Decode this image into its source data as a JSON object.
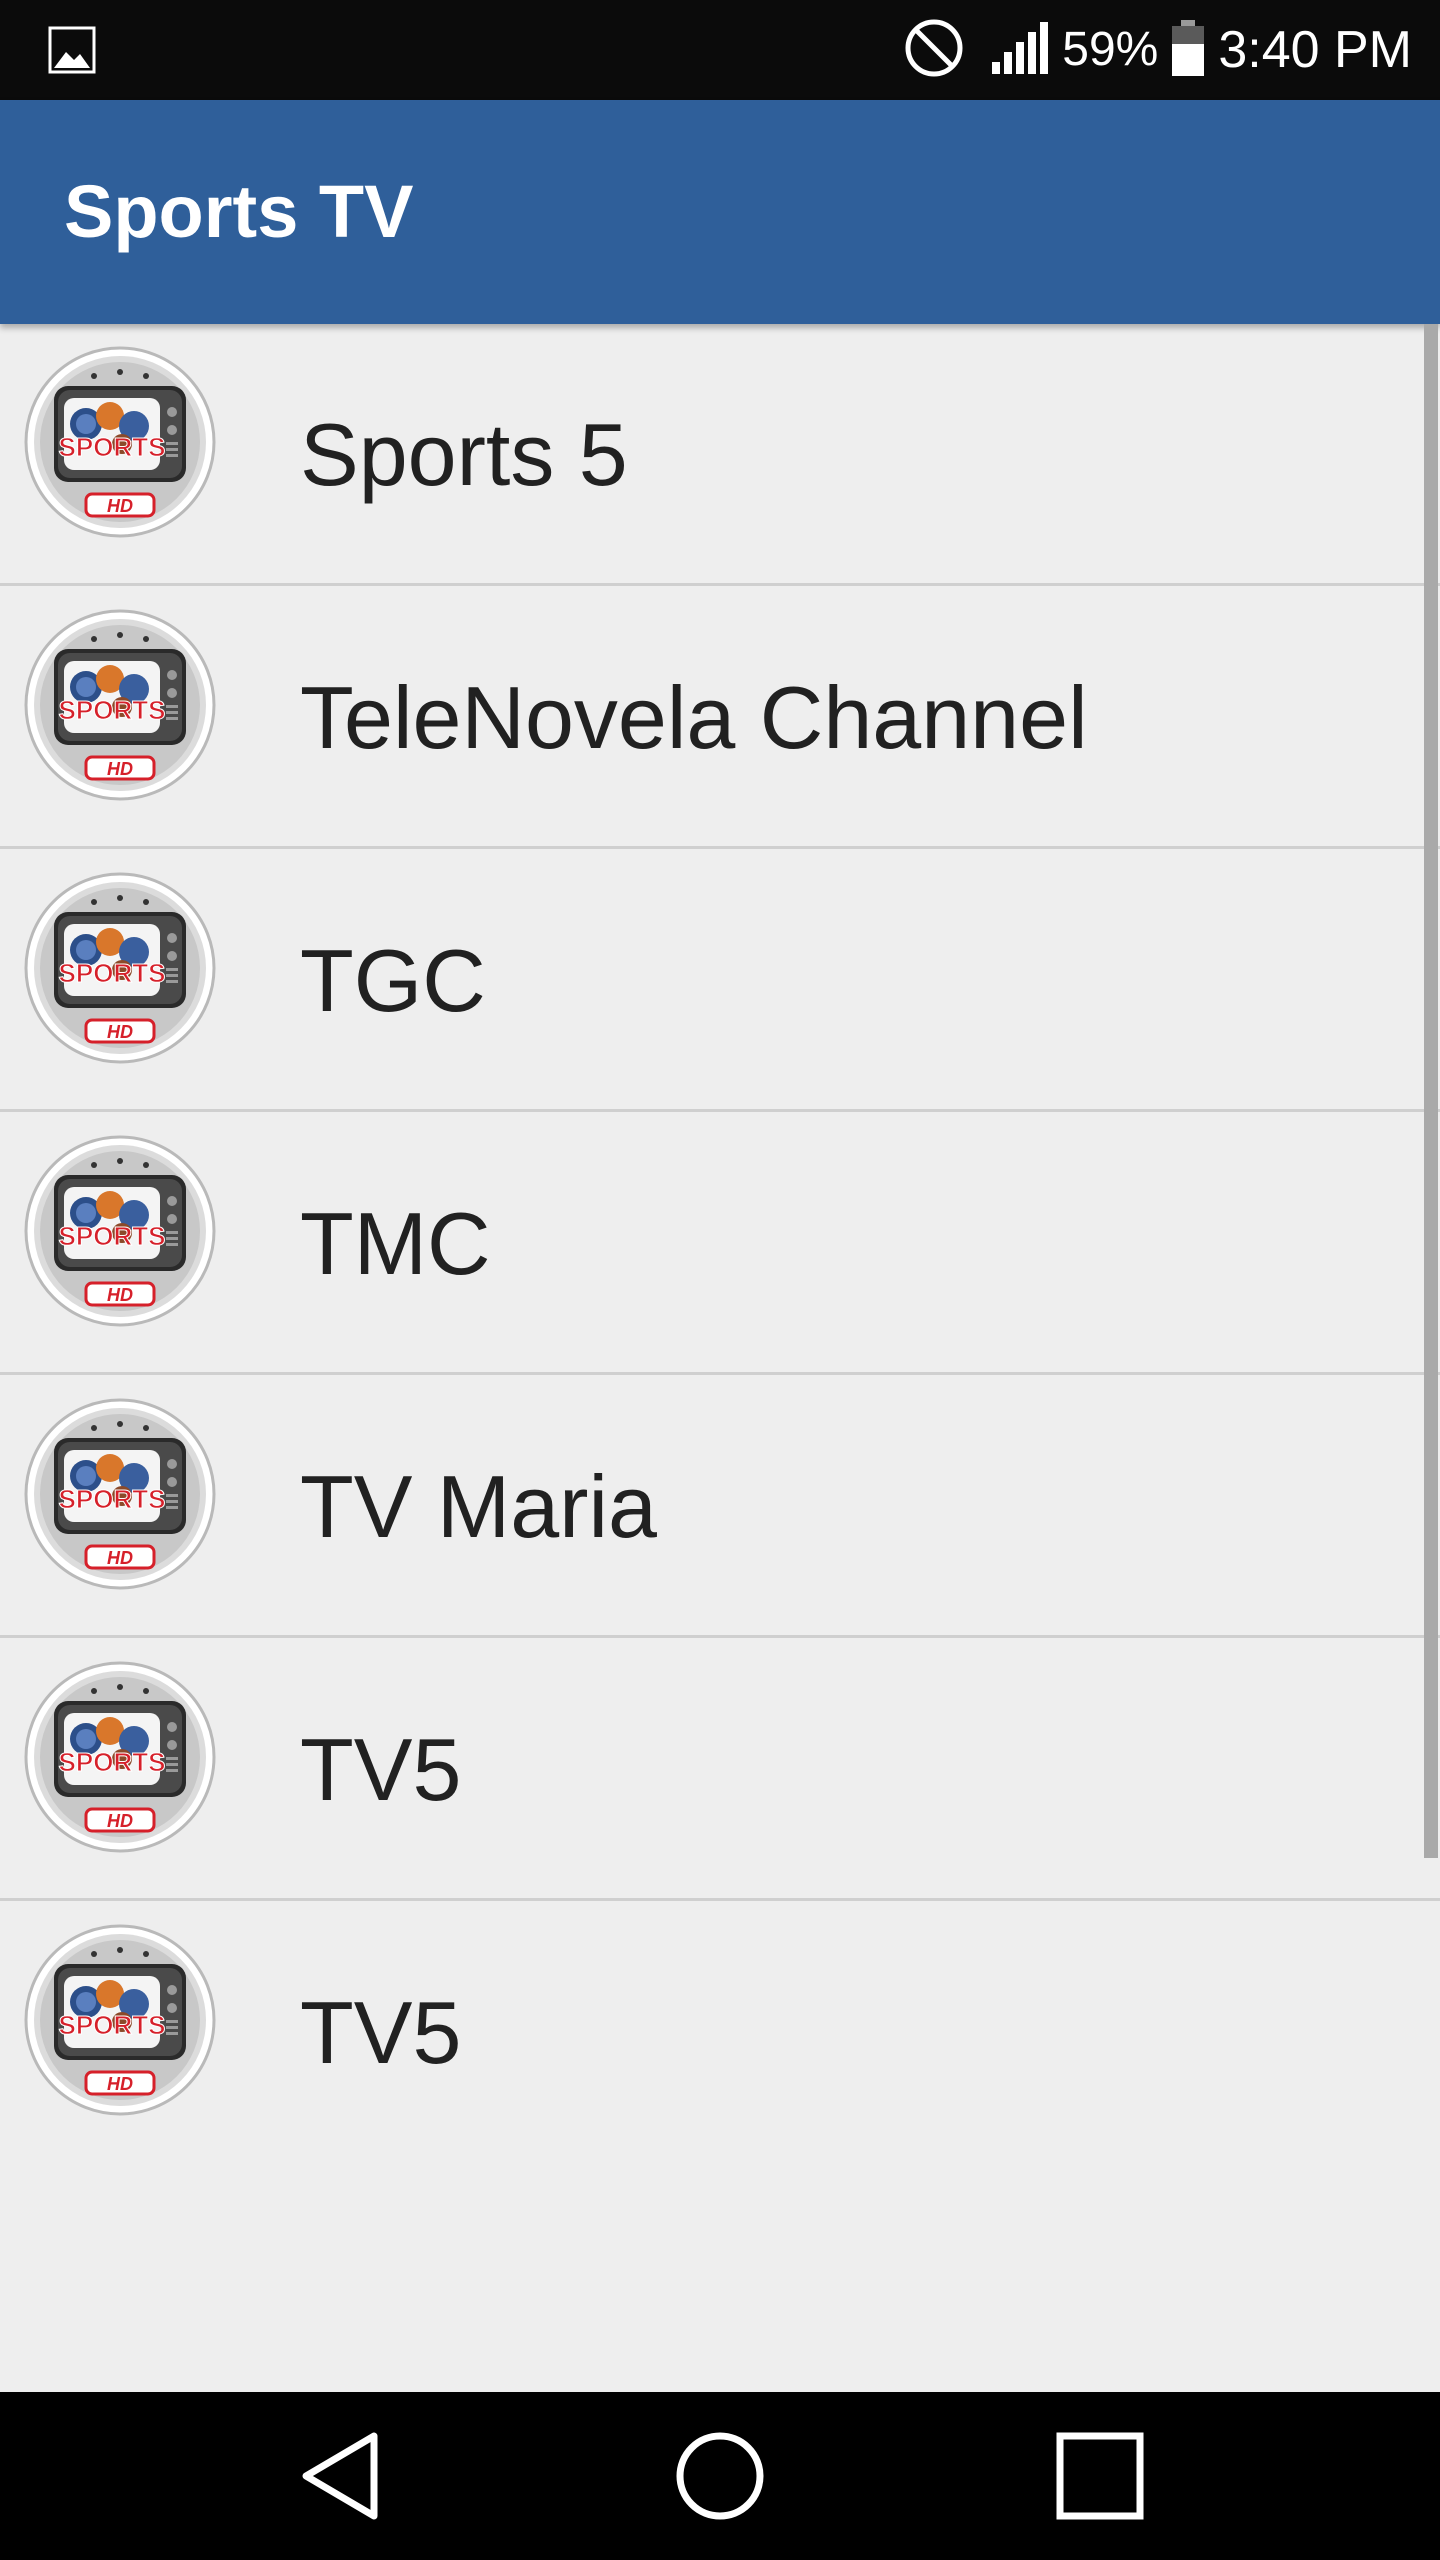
{
  "status_bar": {
    "battery_percent": "59%",
    "time": "3:40 PM",
    "icons": [
      "gallery-icon",
      "do-not-disturb-icon",
      "signal-icon",
      "battery-icon"
    ]
  },
  "app_bar": {
    "title": "Sports TV"
  },
  "channels": [
    {
      "name": "Sports 5",
      "logo": "sports-hd-tv-logo"
    },
    {
      "name": "TeleNovela Channel",
      "logo": "sports-hd-tv-logo"
    },
    {
      "name": "TGC",
      "logo": "sports-hd-tv-logo"
    },
    {
      "name": "TMC",
      "logo": "sports-hd-tv-logo"
    },
    {
      "name": "TV Maria",
      "logo": "sports-hd-tv-logo"
    },
    {
      "name": "TV5",
      "logo": "sports-hd-tv-logo"
    },
    {
      "name": "TV5",
      "logo": "sports-hd-tv-logo"
    }
  ],
  "nav_bar": {
    "buttons": [
      "back-icon",
      "home-icon",
      "recents-icon"
    ]
  },
  "colors": {
    "app_bar": "#2f5f9a",
    "status_bar": "#0b0b0b",
    "list_background": "#eeeeee",
    "divider": "#cfcfcf",
    "text": "#212121",
    "logo_red": "#d6202a"
  }
}
